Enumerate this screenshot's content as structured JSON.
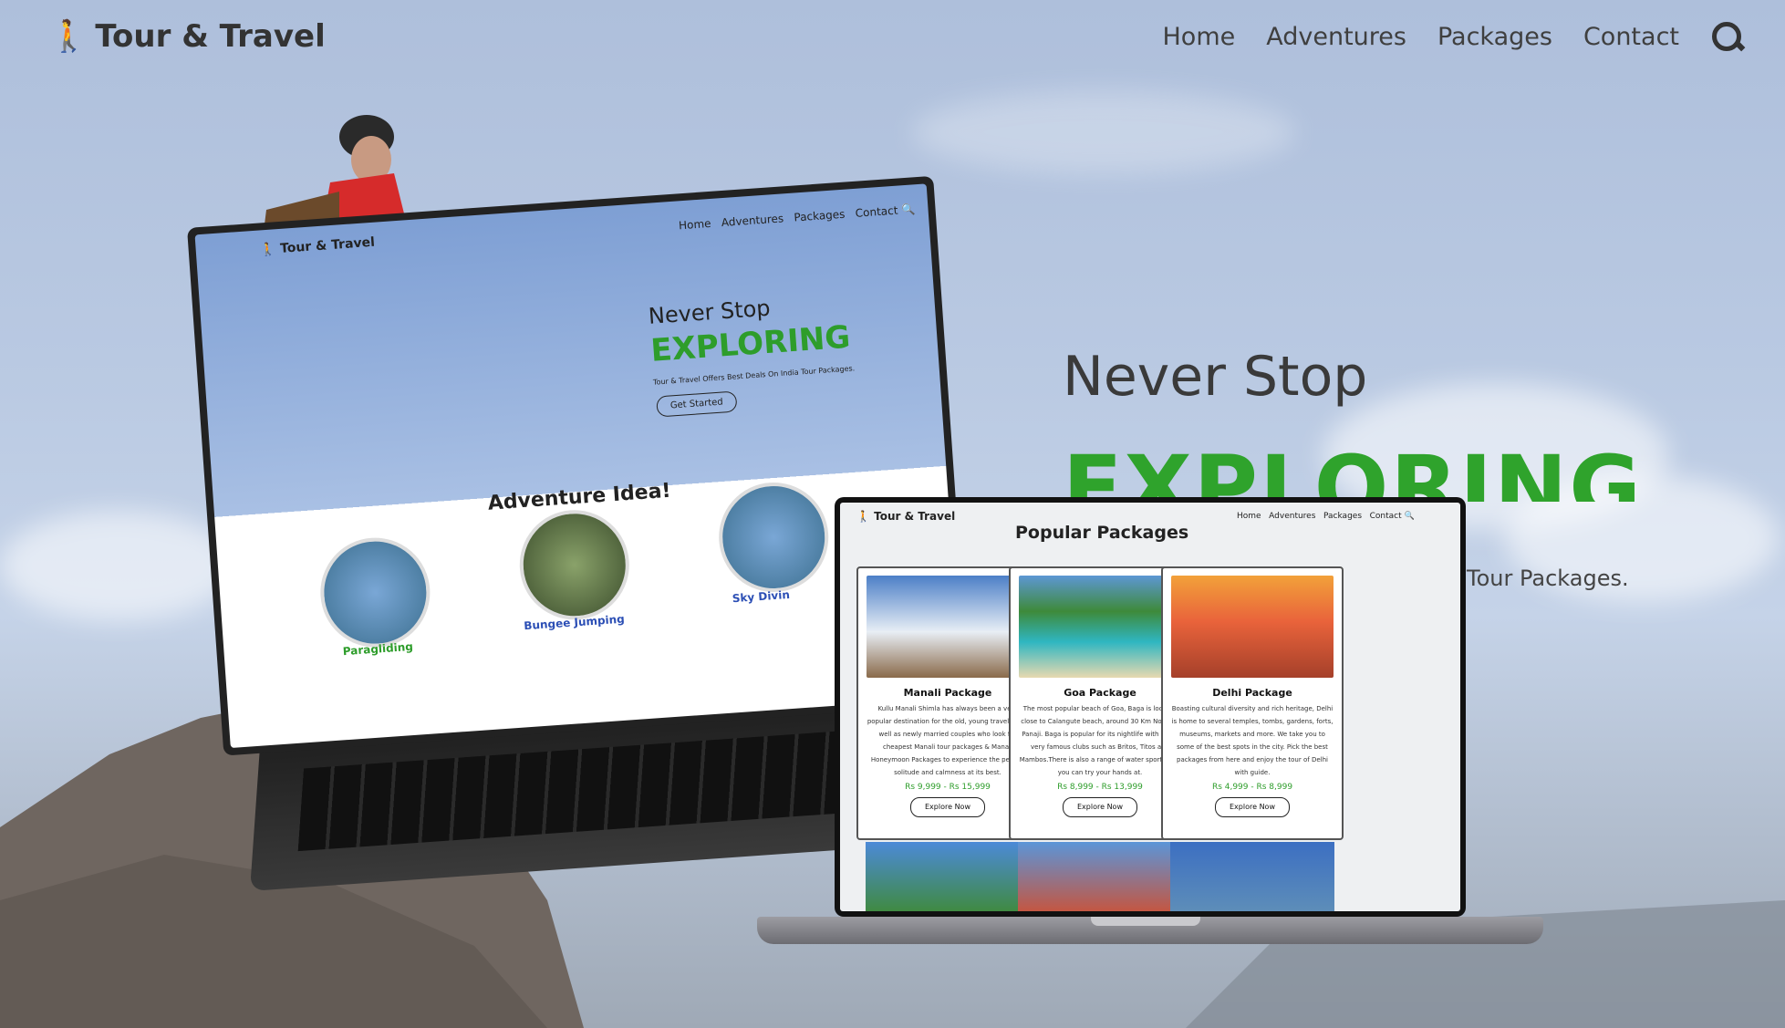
{
  "header": {
    "brand_name": "Tour & Travel",
    "nav": [
      "Home",
      "Adventures",
      "Packages",
      "Contact"
    ],
    "icons": {
      "brand": "hiker-icon",
      "search": "search-icon"
    }
  },
  "hero": {
    "subtitle": "Never Stop",
    "title": "EXPLORING",
    "tagline_partial": "Tour Packages."
  },
  "back_laptop": {
    "brand_name": "Tour & Travel",
    "nav": [
      "Home",
      "Adventures",
      "Packages",
      "Contact"
    ],
    "subtitle": "Never Stop",
    "title": "EXPLORING",
    "tagline": "Tour & Travel Offers Best Deals On India Tour Packages.",
    "cta": "Get Started",
    "section_title": "Adventure Idea!",
    "adventures": [
      "Paragliding",
      "Bungee Jumping",
      "Sky Divin"
    ]
  },
  "front_laptop": {
    "brand_name": "Tour & Travel",
    "nav": [
      "Home",
      "Adventures",
      "Packages",
      "Contact"
    ],
    "section_title": "Popular Packages",
    "packages": [
      {
        "title": "Manali Package",
        "desc": "Kullu Manali Shimla has always been a very popular destination for the old, young travelers as well as newly married couples who look for cheapest Manali tour packages & Manali Honeymoon Packages to experience the perfect solitude and calmness at its best.",
        "price": "Rs 9,999 - Rs 15,999",
        "button": "Explore Now"
      },
      {
        "title": "Goa Package",
        "desc": "The most popular beach of Goa, Baga is located close to Calangute beach, around 30 Km North of Panaji. Baga is popular for its nightlife with some very famous clubs such as Britos, Titos and Mambos.There is also a range of water sports that you can try your hands at.",
        "price": "Rs 8,999 - Rs 13,999",
        "button": "Explore Now"
      },
      {
        "title": "Delhi Package",
        "desc": "Boasting cultural diversity and rich heritage, Delhi is home to several temples, tombs, gardens, forts, museums, markets and more. We take you to some of the best spots in the city. Pick the best packages from here and enjoy the tour of Delhi with guide.",
        "price": "Rs 4,999 - Rs 8,999",
        "button": "Explore Now"
      }
    ]
  },
  "colors": {
    "accent": "#2e9d2b",
    "text": "#3a3a3a"
  }
}
